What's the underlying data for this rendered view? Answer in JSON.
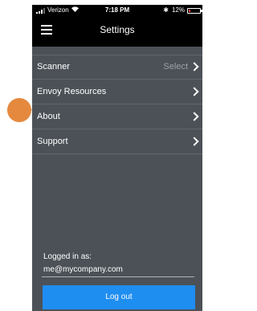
{
  "status_bar": {
    "carrier": "Verizon",
    "time": "7:18 PM",
    "battery": "12%",
    "battery_level": 0.12
  },
  "nav": {
    "title": "Settings"
  },
  "menu": {
    "items": [
      {
        "label": "Scanner",
        "value": "Select"
      },
      {
        "label": "Envoy Resources"
      },
      {
        "label": "About"
      },
      {
        "label": "Support"
      }
    ]
  },
  "account": {
    "logged_in_label": "Logged in as:",
    "email": "me@mycompany.com",
    "logout_label": "Log out"
  },
  "colors": {
    "background": "#4b5157",
    "header": "#000000",
    "accent": "#1f8ef1",
    "marker": "#e5893f"
  },
  "icons": [
    "signal-icon",
    "wifi-icon",
    "bluetooth-icon",
    "battery-icon",
    "hamburger-menu-icon",
    "chevron-right-icon"
  ]
}
